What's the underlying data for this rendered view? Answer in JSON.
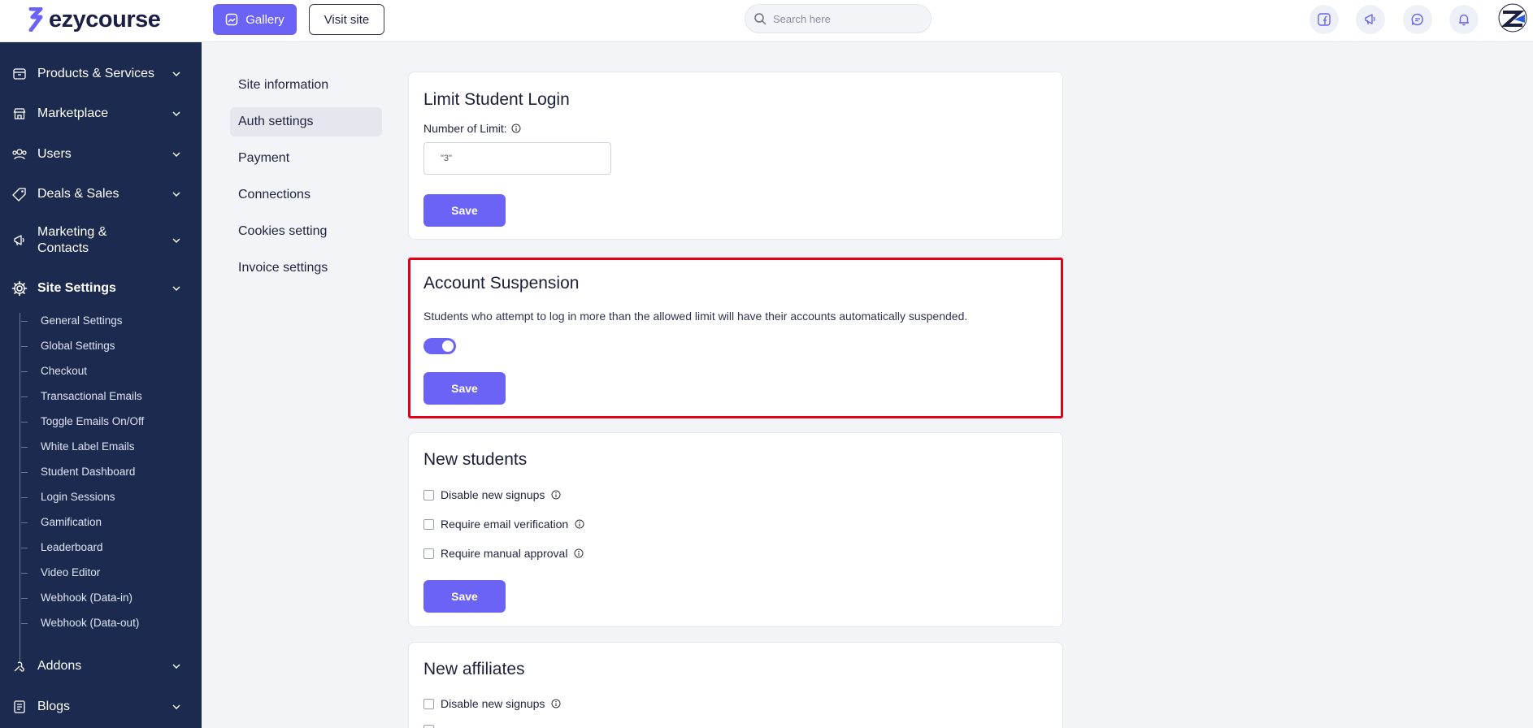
{
  "brand": {
    "name": "ezycourse",
    "accent": "#6a63f5",
    "sidebar_bg": "#1c2a4f"
  },
  "topbar": {
    "gallery_label": "Gallery",
    "visit_label": "Visit site",
    "search_placeholder": "Search here",
    "icons": [
      "facebook-icon",
      "megaphone-icon",
      "chat-icon",
      "bell-icon"
    ]
  },
  "sidebar": {
    "items": [
      {
        "label": "Products & Services",
        "icon": "box-icon"
      },
      {
        "label": "Marketplace",
        "icon": "store-icon"
      },
      {
        "label": "Users",
        "icon": "users-icon"
      },
      {
        "label": "Deals & Sales",
        "icon": "tag-icon"
      },
      {
        "label": "Marketing & Contacts",
        "icon": "megaphone-icon"
      },
      {
        "label": "Site Settings",
        "icon": "gear-icon"
      },
      {
        "label": "Addons",
        "icon": "puzzle-icon"
      },
      {
        "label": "Blogs",
        "icon": "document-icon"
      }
    ],
    "site_settings_sub": [
      "General Settings",
      "Global Settings",
      "Checkout",
      "Transactional Emails",
      "Toggle Emails On/Off",
      "White Label Emails",
      "Student Dashboard",
      "Login Sessions",
      "Gamification",
      "Leaderboard",
      "Video Editor",
      "Webhook (Data-in)",
      "Webhook (Data-out)"
    ]
  },
  "settings_nav": {
    "items": [
      "Site information",
      "Auth settings",
      "Payment",
      "Connections",
      "Cookies setting",
      "Invoice settings"
    ],
    "active": "Auth settings"
  },
  "limit_login": {
    "title": "Limit Student Login",
    "field_label": "Number of Limit:",
    "value": "\"3\"",
    "save": "Save"
  },
  "account_suspension": {
    "title": "Account Suspension",
    "description": "Students who attempt to log in more than the allowed limit will have their accounts automatically suspended.",
    "enabled": true,
    "save": "Save"
  },
  "new_students": {
    "title": "New students",
    "options": [
      "Disable new signups",
      "Require email verification",
      "Require manual approval"
    ],
    "save": "Save"
  },
  "new_affiliates": {
    "title": "New affiliates",
    "options": [
      "Disable new signups"
    ]
  }
}
